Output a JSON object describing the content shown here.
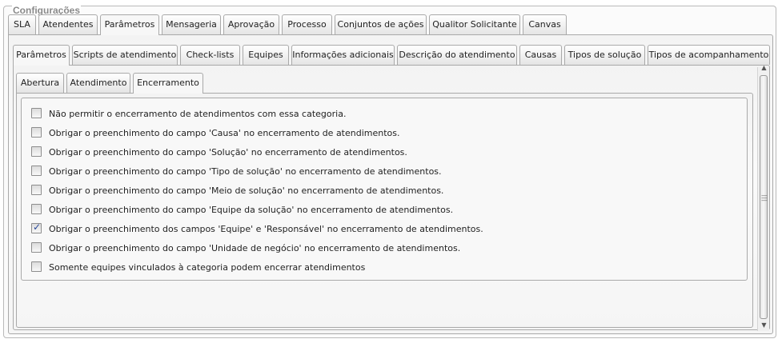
{
  "fieldset": {
    "legend": "Configurações"
  },
  "main_tabs": [
    "SLA",
    "Atendentes",
    "Parâmetros",
    "Mensageria",
    "Aprovação",
    "Processo",
    "Conjuntos de ações",
    "Qualitor Solicitante",
    "Canvas"
  ],
  "main_tabs_active": "Parâmetros",
  "sub_tabs": [
    "Parâmetros",
    "Scripts de atendimento",
    "Check-lists",
    "Equipes",
    "Informações adicionais",
    "Descrição do atendimento",
    "Causas",
    "Tipos de solução",
    "Tipos de acompanhamento"
  ],
  "sub_tabs_active": "Parâmetros",
  "third_tabs": [
    "Abertura",
    "Atendimento",
    "Encerramento"
  ],
  "third_tabs_active": "Encerramento",
  "options": [
    {
      "label": "Não permitir o encerramento de atendimentos com essa categoria.",
      "checked": false
    },
    {
      "label": "Obrigar o preenchimento do campo 'Causa' no encerramento de atendimentos.",
      "checked": false
    },
    {
      "label": "Obrigar o preenchimento do campo 'Solução' no encerramento de atendimentos.",
      "checked": false
    },
    {
      "label": "Obrigar o preenchimento do campo 'Tipo de solução' no encerramento de atendimentos.",
      "checked": false
    },
    {
      "label": "Obrigar o preenchimento do campo 'Meio de solução' no encerramento de atendimentos.",
      "checked": false
    },
    {
      "label": "Obrigar o preenchimento do campo 'Equipe da solução' no encerramento de atendimentos.",
      "checked": false
    },
    {
      "label": "Obrigar o preenchimento dos campos 'Equipe' e 'Responsável' no encerramento de atendimentos.",
      "checked": true
    },
    {
      "label": "Obrigar o preenchimento do campo 'Unidade de negócio' no encerramento de atendimentos.",
      "checked": false
    },
    {
      "label": "Somente equipes vinculados à categoria podem encerrar atendimentos",
      "checked": false
    }
  ]
}
